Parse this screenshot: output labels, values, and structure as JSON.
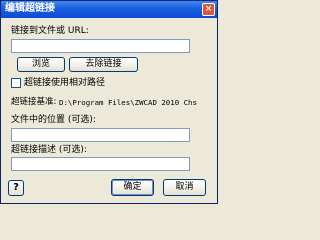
{
  "window": {
    "title": "编辑超链接",
    "close_glyph": "×"
  },
  "link": {
    "label": "链接到文件或 URL:",
    "value": "",
    "browse_label": "浏览",
    "remove_label": "去除链接",
    "relative_path_label": "超链接使用相对路径",
    "relative_path_checked": false,
    "base_label": "超链接基准:",
    "base_value": "D:\\Program Files\\ZWCAD 2010 Chs"
  },
  "location": {
    "label": "文件中的位置 (可选):",
    "value": ""
  },
  "description": {
    "label": "超链接描述 (可选):",
    "value": ""
  },
  "footer": {
    "help_label": "?",
    "ok_label": "确定",
    "cancel_label": "取消"
  }
}
